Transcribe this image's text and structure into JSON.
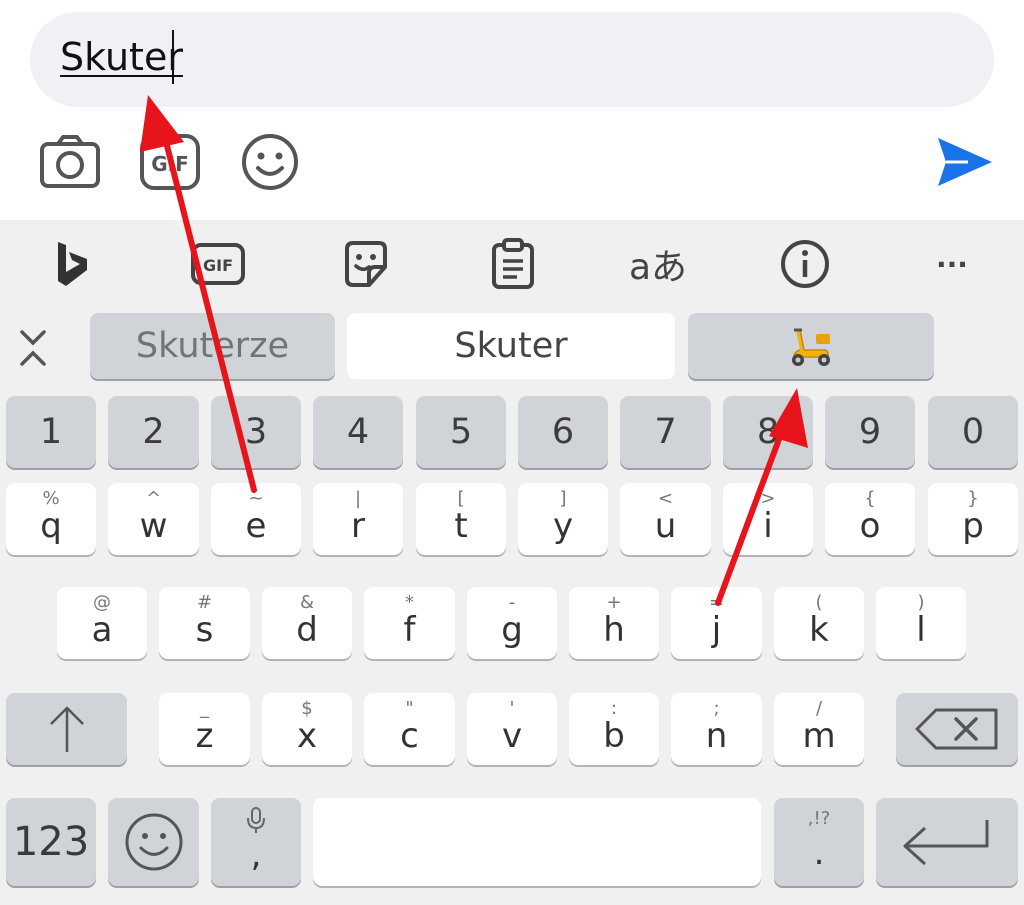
{
  "composer": {
    "text_value": "Skuter",
    "icons": {
      "camera": "camera-icon",
      "gif": "gif-icon",
      "emoji": "emoji-icon",
      "send": "send-icon"
    },
    "send_color": "#1a73e8"
  },
  "keyboard": {
    "toolbar": [
      "bing-icon",
      "gif-icon",
      "sticker-icon",
      "clipboard-icon",
      "translate-icon",
      "info-icon",
      "more-icon"
    ],
    "toolbar_gif_label": "GIF",
    "translate_label": "aあ",
    "more_label": "···",
    "candidates": [
      {
        "label": "Skuterze"
      },
      {
        "label": "Skuter"
      },
      {
        "label": "🛵"
      }
    ],
    "numbers": [
      "1",
      "2",
      "3",
      "4",
      "5",
      "6",
      "7",
      "8",
      "9",
      "0"
    ],
    "row_q": [
      {
        "main": "q",
        "hint": "%"
      },
      {
        "main": "w",
        "hint": "^"
      },
      {
        "main": "e",
        "hint": "~"
      },
      {
        "main": "r",
        "hint": "|"
      },
      {
        "main": "t",
        "hint": "["
      },
      {
        "main": "y",
        "hint": "]"
      },
      {
        "main": "u",
        "hint": "<"
      },
      {
        "main": "i",
        "hint": ">"
      },
      {
        "main": "o",
        "hint": "{"
      },
      {
        "main": "p",
        "hint": "}"
      }
    ],
    "row_a": [
      {
        "main": "a",
        "hint": "@"
      },
      {
        "main": "s",
        "hint": "#"
      },
      {
        "main": "d",
        "hint": "&"
      },
      {
        "main": "f",
        "hint": "*"
      },
      {
        "main": "g",
        "hint": "-"
      },
      {
        "main": "h",
        "hint": "+"
      },
      {
        "main": "j",
        "hint": "="
      },
      {
        "main": "k",
        "hint": "("
      },
      {
        "main": "l",
        "hint": ")"
      }
    ],
    "row_z": [
      {
        "main": "z",
        "hint": "_"
      },
      {
        "main": "x",
        "hint": "$"
      },
      {
        "main": "c",
        "hint": "\""
      },
      {
        "main": "v",
        "hint": "'"
      },
      {
        "main": "b",
        "hint": ":"
      },
      {
        "main": "n",
        "hint": ";"
      },
      {
        "main": "m",
        "hint": "/"
      }
    ],
    "bottom": {
      "mode_label": "123",
      "comma_label": ",",
      "period_label": ".",
      "period_hint": ",!?"
    }
  },
  "annotation_color": "#e8141b"
}
